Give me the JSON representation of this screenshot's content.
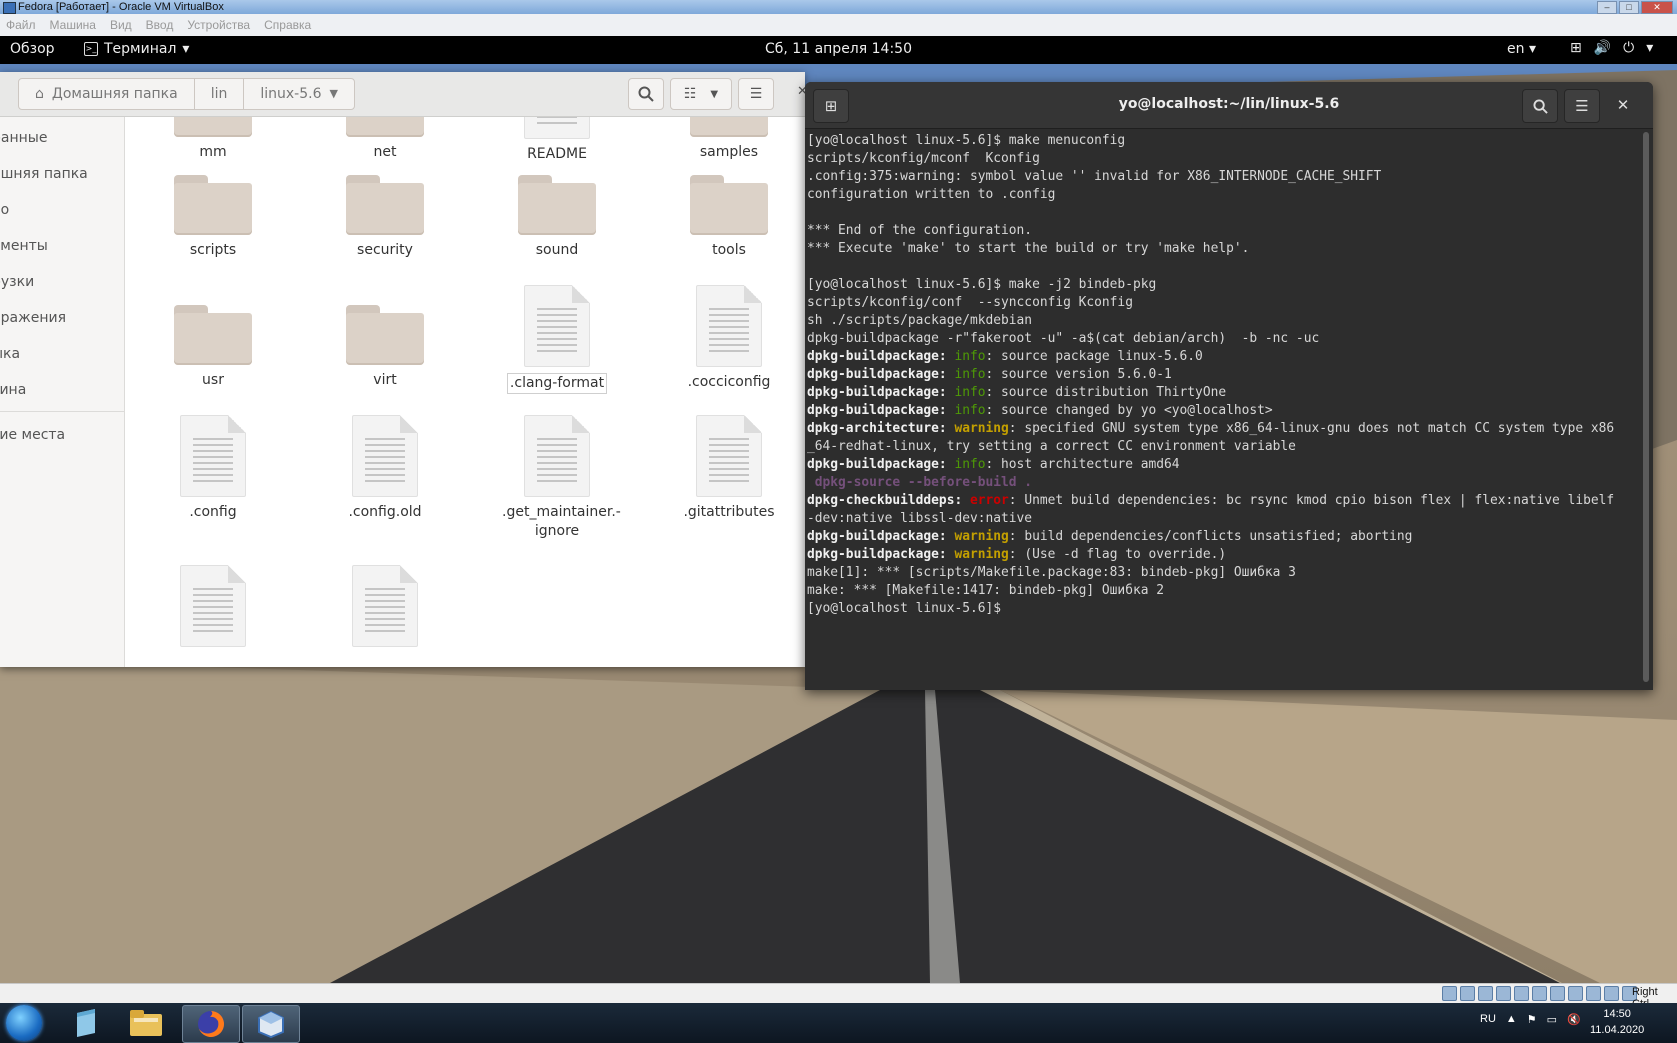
{
  "vbox": {
    "title": "Fedora [Работает] - Oracle VM VirtualBox",
    "menu": [
      "Файл",
      "Машина",
      "Вид",
      "Ввод",
      "Устройства",
      "Справка"
    ],
    "status_right": "Right Ctrl"
  },
  "topbar": {
    "activities": "Обзор",
    "app_menu": "Терминал",
    "clock": "Сб, 11 апреля  14:50",
    "lang": "en"
  },
  "files": {
    "path": [
      "Домашняя папка",
      "lin",
      "linux-5.6"
    ],
    "sidebar": [
      "ранные",
      "ашняя папка",
      "ео",
      "ументы",
      "рузки",
      "бражения",
      "ыка",
      "зина",
      "гие места"
    ],
    "items": [
      {
        "name": "mm",
        "type": "folder"
      },
      {
        "name": "net",
        "type": "folder"
      },
      {
        "name": "README",
        "type": "doc"
      },
      {
        "name": "samples",
        "type": "folder"
      },
      {
        "name": "scripts",
        "type": "folder"
      },
      {
        "name": "security",
        "type": "folder"
      },
      {
        "name": "sound",
        "type": "folder"
      },
      {
        "name": "tools",
        "type": "folder"
      },
      {
        "name": "usr",
        "type": "folder"
      },
      {
        "name": "virt",
        "type": "folder"
      },
      {
        "name": ".clang-format",
        "type": "doc"
      },
      {
        "name": ".cocciconfig",
        "type": "doc"
      },
      {
        "name": ".config",
        "type": "doc"
      },
      {
        "name": ".config.old",
        "type": "doc"
      },
      {
        "name": ".get_maintainer.-ignore",
        "type": "doc"
      },
      {
        "name": ".gitattributes",
        "type": "doc"
      },
      {
        "name": "",
        "type": "doc"
      },
      {
        "name": "",
        "type": "doc"
      }
    ]
  },
  "terminal": {
    "title": "yo@localhost:~/lin/linux-5.6",
    "lines": [
      {
        "segs": [
          {
            "t": "[yo@localhost linux-5.6]$ make menuconfig"
          }
        ]
      },
      {
        "segs": [
          {
            "t": "scripts/kconfig/mconf  Kconfig"
          }
        ]
      },
      {
        "segs": [
          {
            "t": ".config:375:warning: symbol value '' invalid for X86_INTERNODE_CACHE_SHIFT"
          }
        ]
      },
      {
        "segs": [
          {
            "t": "configuration written to .config"
          }
        ]
      },
      {
        "segs": [
          {
            "t": ""
          }
        ]
      },
      {
        "segs": [
          {
            "t": "*** End of the configuration."
          }
        ]
      },
      {
        "segs": [
          {
            "t": "*** Execute 'make' to start the build or try 'make help'."
          }
        ]
      },
      {
        "segs": [
          {
            "t": ""
          }
        ]
      },
      {
        "segs": [
          {
            "t": "[yo@localhost linux-5.6]$ make -j2 bindeb-pkg"
          }
        ]
      },
      {
        "segs": [
          {
            "t": "scripts/kconfig/conf  --syncconfig Kconfig"
          }
        ]
      },
      {
        "segs": [
          {
            "t": "sh ./scripts/package/mkdebian"
          }
        ]
      },
      {
        "segs": [
          {
            "t": "dpkg-buildpackage -r\"fakeroot -u\" -a$(cat debian/arch)  -b -nc -uc"
          }
        ]
      },
      {
        "segs": [
          {
            "t": "dpkg-buildpackage:",
            "c": "b"
          },
          {
            "t": " "
          },
          {
            "t": "info",
            "c": "info"
          },
          {
            "t": ": source package linux-5.6.0"
          }
        ]
      },
      {
        "segs": [
          {
            "t": "dpkg-buildpackage:",
            "c": "b"
          },
          {
            "t": " "
          },
          {
            "t": "info",
            "c": "info"
          },
          {
            "t": ": source version 5.6.0-1"
          }
        ]
      },
      {
        "segs": [
          {
            "t": "dpkg-buildpackage:",
            "c": "b"
          },
          {
            "t": " "
          },
          {
            "t": "info",
            "c": "info"
          },
          {
            "t": ": source distribution ThirtyOne"
          }
        ]
      },
      {
        "segs": [
          {
            "t": "dpkg-buildpackage:",
            "c": "b"
          },
          {
            "t": " "
          },
          {
            "t": "info",
            "c": "info"
          },
          {
            "t": ": source changed by yo <yo@localhost>"
          }
        ]
      },
      {
        "segs": [
          {
            "t": "dpkg-architecture:",
            "c": "b"
          },
          {
            "t": " "
          },
          {
            "t": "warning",
            "c": "warn"
          },
          {
            "t": ": specified GNU system type x86_64-linux-gnu does not match CC system type x86"
          }
        ]
      },
      {
        "segs": [
          {
            "t": "_64-redhat-linux, try setting a correct CC environment variable"
          }
        ]
      },
      {
        "segs": [
          {
            "t": "dpkg-buildpackage:",
            "c": "b"
          },
          {
            "t": " "
          },
          {
            "t": "info",
            "c": "info"
          },
          {
            "t": ": host architecture amd64"
          }
        ]
      },
      {
        "segs": [
          {
            "t": " dpkg-source --before-build .",
            "c": "dim"
          }
        ]
      },
      {
        "segs": [
          {
            "t": "dpkg-checkbuilddeps:",
            "c": "b"
          },
          {
            "t": " "
          },
          {
            "t": "error",
            "c": "err"
          },
          {
            "t": ": Unmet build dependencies: bc rsync kmod cpio bison flex | flex:native libelf"
          }
        ]
      },
      {
        "segs": [
          {
            "t": "-dev:native libssl-dev:native"
          }
        ]
      },
      {
        "segs": [
          {
            "t": "dpkg-buildpackage:",
            "c": "b"
          },
          {
            "t": " "
          },
          {
            "t": "warning",
            "c": "warn"
          },
          {
            "t": ": build dependencies/conflicts unsatisfied; aborting"
          }
        ]
      },
      {
        "segs": [
          {
            "t": "dpkg-buildpackage:",
            "c": "b"
          },
          {
            "t": " "
          },
          {
            "t": "warning",
            "c": "warn"
          },
          {
            "t": ": (Use -d flag to override.)"
          }
        ]
      },
      {
        "segs": [
          {
            "t": "make[1]: *** [scripts/Makefile.package:83: bindeb-pkg] Ошибка 3"
          }
        ]
      },
      {
        "segs": [
          {
            "t": "make: *** [Makefile:1417: bindeb-pkg] Ошибка 2"
          }
        ]
      },
      {
        "segs": [
          {
            "t": "[yo@localhost linux-5.6]$ "
          }
        ]
      }
    ]
  },
  "tray": {
    "lang": "RU",
    "time": "14:50",
    "date": "11.04.2020"
  },
  "colors": {
    "info": "#4e9a06",
    "warning": "#c4a000",
    "error": "#cc0000",
    "terminal_bg": "#2d2d2d"
  }
}
